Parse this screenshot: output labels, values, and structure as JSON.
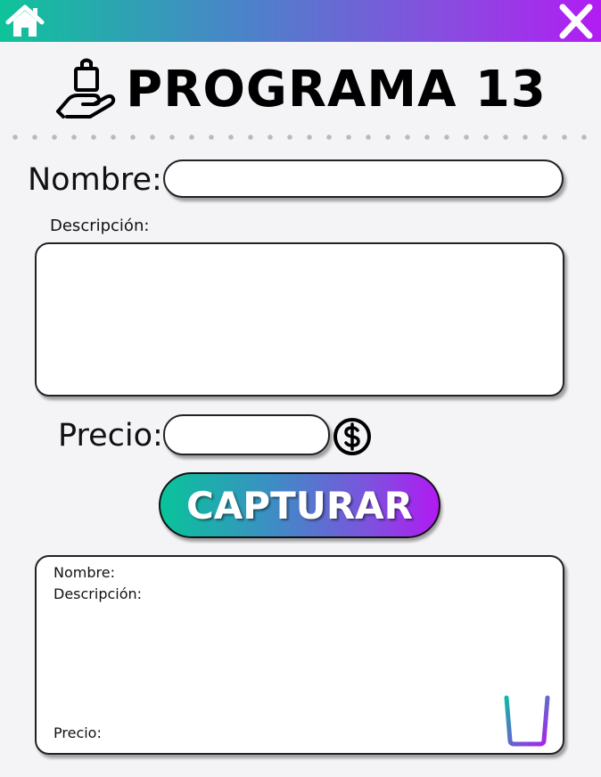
{
  "header": {
    "home_icon": "home-icon",
    "close_icon": "close-icon",
    "gradient_colors": [
      "#0fc39a",
      "#4a84c9",
      "#8a4be0",
      "#b21cf3"
    ]
  },
  "title": {
    "text": "PROGRAMA 13",
    "icon": "shopping-bag-hand-icon"
  },
  "form": {
    "nombre_label": "Nombre:",
    "nombre_value": "",
    "descripcion_label": "Descripción:",
    "descripcion_value": "",
    "precio_label": "Precio:",
    "precio_value": "",
    "currency_icon": "dollar-icon",
    "capture_label": "CAPTURAR"
  },
  "result": {
    "nombre_label": "Nombre:",
    "descripcion_label": "Descripción:",
    "precio_label": "Precio:",
    "delete_icon": "trash-icon"
  }
}
